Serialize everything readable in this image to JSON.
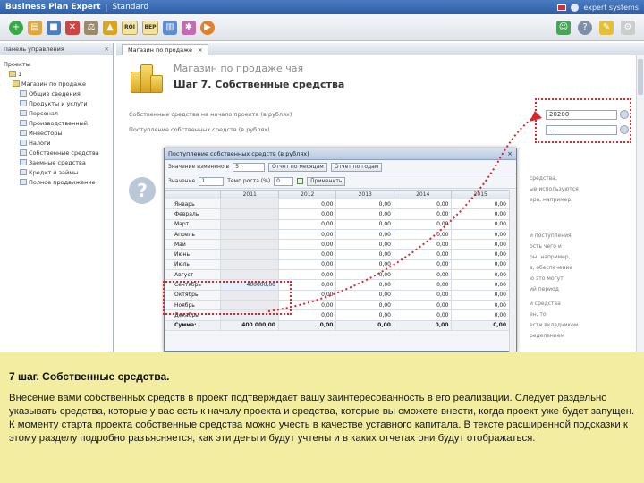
{
  "window": {
    "app_title": "Business Plan Expert",
    "edition": "Standard",
    "brand": "expert systems"
  },
  "toolbar": {
    "buttons": [
      {
        "icon": "add-icon",
        "color": "#3aa84a"
      },
      {
        "icon": "open-icon",
        "color": "#e0a83a"
      },
      {
        "icon": "save-icon",
        "color": "#4d7cc3"
      },
      {
        "icon": "delete-icon",
        "color": "#c44"
      },
      {
        "icon": "scales-icon",
        "color": "#9a8a6a"
      },
      {
        "icon": "warning-icon",
        "color": "#d9a520"
      },
      {
        "icon": "roi-icon",
        "label": "ROI"
      },
      {
        "icon": "break-even-icon",
        "label": "BEP"
      },
      {
        "icon": "chart-icon",
        "color": "#5b8bd0"
      },
      {
        "icon": "tool-icon",
        "color": "#c46ab0"
      },
      {
        "icon": "play-icon",
        "color": "#e0822c"
      }
    ]
  },
  "left_panel": {
    "title": "Панель управления",
    "root": "Проекты",
    "items": [
      "1",
      "Магазин по продаже",
      "Общие сведения",
      "Продукты и услуги",
      "Персонал",
      "Производственный",
      "Инвесторы",
      "Налоги",
      "Собственные средства",
      "Заемные средства",
      "Кредит и займы",
      "Полное продвижение"
    ]
  },
  "doc": {
    "tab_label": "Магазин по продаже",
    "title": "Магазин по продаже чая",
    "step": "Шаг 7. Собственные средства",
    "fields": [
      {
        "label": "Собственные средства на начало проекта (в рублях)",
        "value": "20200"
      },
      {
        "label": "Поступление собственных средств (в рублях)",
        "value": "..."
      }
    ],
    "side_text": [
      "средства,",
      "ые используются",
      "ера, например,",
      "и поступления",
      "ость чего и",
      "ры, например,",
      "в, обеспечение",
      "ю это могут",
      "ий период",
      "и средства",
      "ен, то",
      "ести вкладчиком",
      "ределением"
    ]
  },
  "dialog": {
    "title": "Поступление собственных средств (в рублях)",
    "bar1": {
      "label": "Значение изменено в",
      "select": "5",
      "btn1": "Отчет по месяцам",
      "btn2": "Отчет по годам"
    },
    "bar2": {
      "label": "Значение",
      "value": "1",
      "label2": "Темп роста (%)",
      "value2": "0",
      "btn": "Применить"
    },
    "years": [
      "",
      "2011",
      "2012",
      "2013",
      "2014",
      "2015"
    ],
    "rows": [
      [
        "Январь",
        "",
        "0,00",
        "0,00",
        "0,00",
        "0,00"
      ],
      [
        "Февраль",
        "",
        "0,00",
        "0,00",
        "0,00",
        "0,00"
      ],
      [
        "Март",
        "",
        "0,00",
        "0,00",
        "0,00",
        "0,00"
      ],
      [
        "Апрель",
        "",
        "0,00",
        "0,00",
        "0,00",
        "0,00"
      ],
      [
        "Май",
        "",
        "0,00",
        "0,00",
        "0,00",
        "0,00"
      ],
      [
        "Июнь",
        "",
        "0,00",
        "0,00",
        "0,00",
        "0,00"
      ],
      [
        "Июль",
        "",
        "0,00",
        "0,00",
        "0,00",
        "0,00"
      ],
      [
        "Август",
        "",
        "0,00",
        "0,00",
        "0,00",
        "0,00"
      ],
      [
        "Сентябрь",
        "400000,00",
        "0,00",
        "0,00",
        "0,00",
        "0,00"
      ],
      [
        "Октябрь",
        "",
        "0,00",
        "0,00",
        "0,00",
        "0,00"
      ],
      [
        "Ноябрь",
        "",
        "0,00",
        "0,00",
        "0,00",
        "0,00"
      ],
      [
        "Декабрь",
        "",
        "0,00",
        "0,00",
        "0,00",
        "0,00"
      ]
    ],
    "sum_row": [
      "Сумма:",
      "400 000,00",
      "0,00",
      "0,00",
      "0,00",
      "0,00"
    ]
  },
  "overlay": {
    "title": "7 шаг. Собственные средства.",
    "text": "Внесение вами собственных средств в проект подтверждает вашу заинтересованность в его реализации. Следует раздельно указывать средства, которые у вас есть к началу проекта и средства, которые вы сможете внести, когда проект уже будет запущен. К моменту старта проекта собственные средства можно учесть в качестве уставного капитала. В тексте расширенной подсказки к этому разделу подробно разъясняется, как эти деньги будут учтены и в каких отчетах они будут отображаться."
  }
}
